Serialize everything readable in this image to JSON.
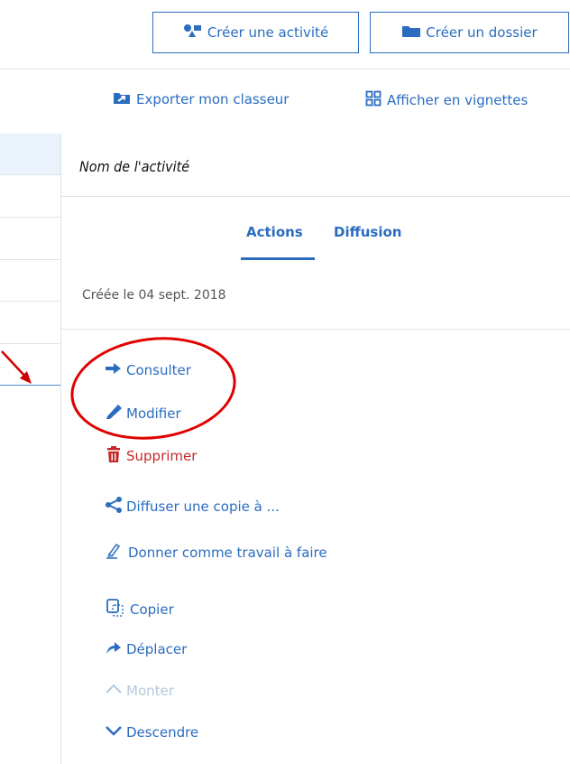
{
  "toolbar": {
    "create_activity": "Créer une activité",
    "create_folder": "Créer un dossier"
  },
  "links": {
    "export": "Exporter mon classeur",
    "thumbnails": "Afficher en vignettes"
  },
  "panel": {
    "title": "Nom de l'activité",
    "tabs": [
      {
        "label": "Actions",
        "active": true
      },
      {
        "label": "Diffusion",
        "active": false
      }
    ],
    "created": "Créée le 04 sept. 2018",
    "actions": [
      {
        "label": "Consulter",
        "icon": "arrow-right-icon"
      },
      {
        "label": "Modifier",
        "icon": "pencil-icon"
      },
      {
        "label": "Supprimer",
        "icon": "trash-icon"
      },
      {
        "label": "Diffuser une copie à ...",
        "icon": "share-icon"
      },
      {
        "label": "Donner comme travail à faire",
        "icon": "assign-homework-icon"
      },
      {
        "label": "Copier",
        "icon": "copy-icon"
      },
      {
        "label": "Déplacer",
        "icon": "move-arrow-icon"
      },
      {
        "label": "Monter",
        "icon": "chevron-up-icon"
      },
      {
        "label": "Descendre",
        "icon": "chevron-down-icon"
      }
    ]
  },
  "colors": {
    "accent": "#2a6cc0",
    "danger": "#c62828",
    "disabled": "#b5c8dc",
    "annotation": "#e00000"
  }
}
